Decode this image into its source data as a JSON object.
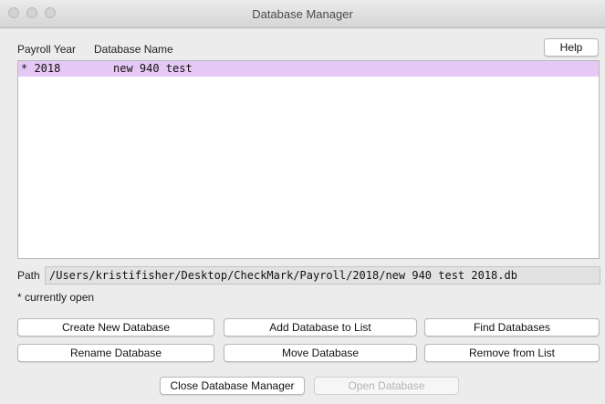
{
  "window": {
    "title": "Database Manager"
  },
  "columns": {
    "year": "Payroll Year",
    "name": "Database Name"
  },
  "help_label": "Help",
  "databases": [
    {
      "year": "* 2018",
      "name": "new 940 test"
    }
  ],
  "path": {
    "label": "Path",
    "value": "/Users/kristifisher/Desktop/CheckMark/Payroll/2018/new 940 test 2018.db"
  },
  "note": "* currently open",
  "buttons": {
    "create": "Create New Database",
    "add": "Add Database to List",
    "find": "Find Databases",
    "rename": "Rename Database",
    "move": "Move Database",
    "remove": "Remove from List",
    "close": "Close Database Manager",
    "open": "Open Database"
  },
  "colors": {
    "selection": "#e6c8f4",
    "window_bg": "#ececec"
  }
}
